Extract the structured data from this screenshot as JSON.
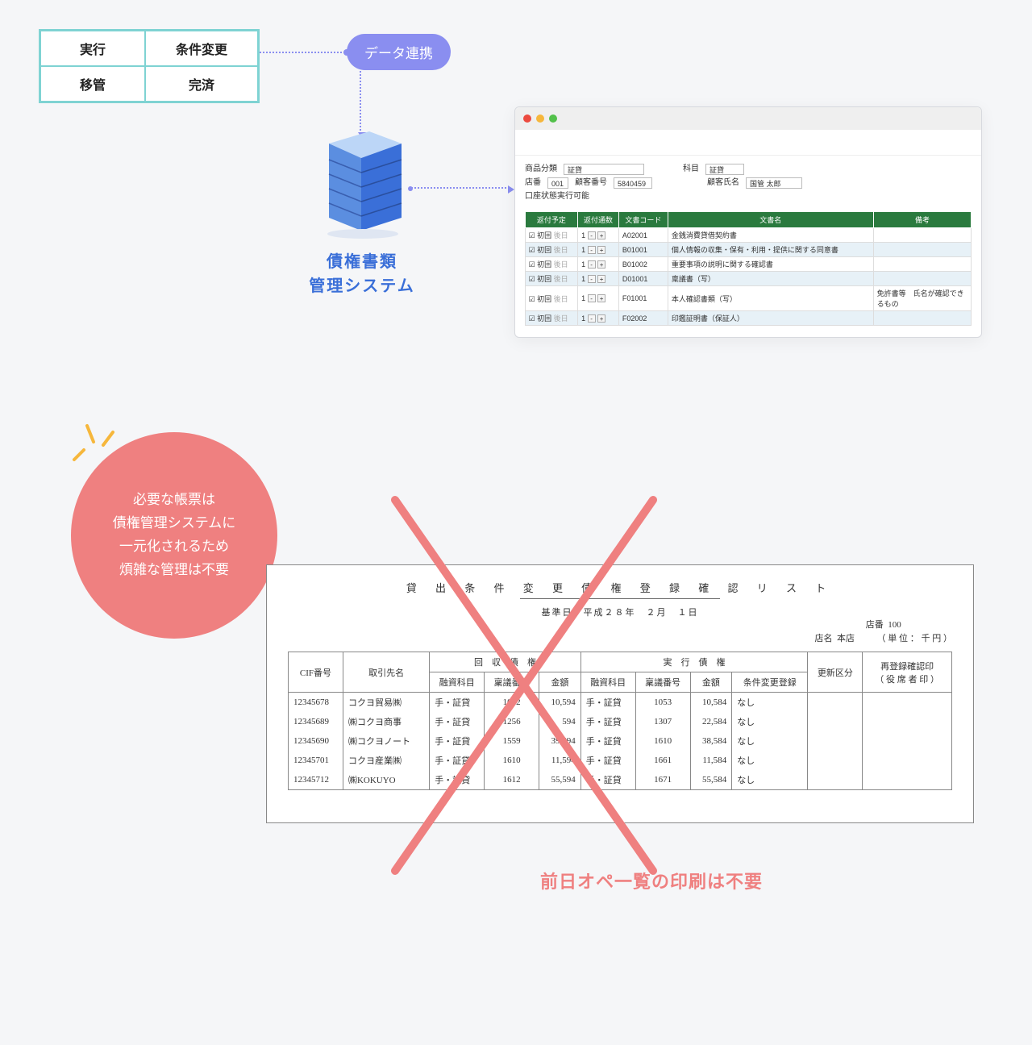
{
  "grid": {
    "a": "実行",
    "b": "条件変更",
    "c": "移管",
    "d": "完済"
  },
  "pill": "データ連携",
  "server_label_1": "債権書類",
  "server_label_2": "管理システム",
  "form": {
    "l_category": "商品分類",
    "v_category": "証貸",
    "l_subject": "科目",
    "v_subject": "証貸",
    "l_branch": "店番",
    "v_branch": "001",
    "l_custno": "顧客番号",
    "v_custno": "5840459",
    "l_custname": "顧客氏名",
    "v_custname": "国管 太郎",
    "status": "口座状態実行可能"
  },
  "doc_headers": {
    "c1": "返付予定",
    "c2": "返付通数",
    "c3": "文書コード",
    "c4": "文書名",
    "c5": "備考"
  },
  "doc_rows": [
    {
      "t": "初回",
      "code": "A02001",
      "name": "金銭消費貸借契約書",
      "remark": ""
    },
    {
      "t": "初回",
      "code": "B01001",
      "name": "個人情報の収集・保有・利用・提供に関する同意書",
      "remark": ""
    },
    {
      "t": "初回",
      "code": "B01002",
      "name": "重要事項の説明に関する確認書",
      "remark": ""
    },
    {
      "t": "初回",
      "code": "D01001",
      "name": "稟議書（写）",
      "remark": ""
    },
    {
      "t": "初回",
      "code": "F01001",
      "name": "本人確認書類（写）",
      "remark": "免許書等　氏名が確認できるもの"
    },
    {
      "t": "初回",
      "code": "F02002",
      "name": "印鑑証明書（保証人）",
      "remark": ""
    }
  ],
  "circle": {
    "l1": "必要な帳票は",
    "l2": "債権管理システムに",
    "l3": "一元化されるため",
    "l4": "煩雑な管理は不要"
  },
  "report": {
    "title": "貸 出 条 件 変 更 債 権 登 録 確 認 リ ス ト",
    "date": "基準日　平成２８年　２月　１日",
    "branch_no_l": "店番",
    "branch_no": "100",
    "branch_nm_l": "店名",
    "branch_nm": "本店",
    "unit": "（ 単 位 ： 千 円 ）",
    "h_cif": "CIF番号",
    "h_client": "取引先名",
    "h_group1": "回　収　債　権",
    "h_group2": "実　行　債　権",
    "h_subj": "融資科目",
    "h_ringi": "稟議番号",
    "h_amt": "金額",
    "h_cond": "条件変更登録",
    "h_update": "更新区分",
    "h_seal_1": "再登録確認印",
    "h_seal_2": "（ 役 席 者 印 ）"
  },
  "report_rows": [
    {
      "cif": "12345678",
      "client": "コクヨ貿易㈱",
      "s1": "手・証貸",
      "r1": "1002",
      "a1": "10,594",
      "s2": "手・証貸",
      "r2": "1053",
      "a2": "10,584",
      "c": "なし"
    },
    {
      "cif": "12345689",
      "client": "㈱コクヨ商事",
      "s1": "手・証貸",
      "r1": "1256",
      "a1": "594",
      "s2": "手・証貸",
      "r2": "1307",
      "a2": "22,584",
      "c": "なし"
    },
    {
      "cif": "12345690",
      "client": "㈱コクヨノート",
      "s1": "手・証貸",
      "r1": "1559",
      "a1": "39,594",
      "s2": "手・証貸",
      "r2": "1610",
      "a2": "38,584",
      "c": "なし"
    },
    {
      "cif": "12345701",
      "client": "コクヨ産業㈱",
      "s1": "手・証貸",
      "r1": "1610",
      "a1": "11,594",
      "s2": "手・証貸",
      "r2": "1661",
      "a2": "11,584",
      "c": "なし"
    },
    {
      "cif": "12345712",
      "client": "㈱KOKUYO",
      "s1": "手・証貸",
      "r1": "1612",
      "a1": "55,594",
      "s2": "手・証貸",
      "r2": "1671",
      "a2": "55,584",
      "c": "なし"
    }
  ],
  "caption_red": "前日オペ一覧の印刷は不要"
}
